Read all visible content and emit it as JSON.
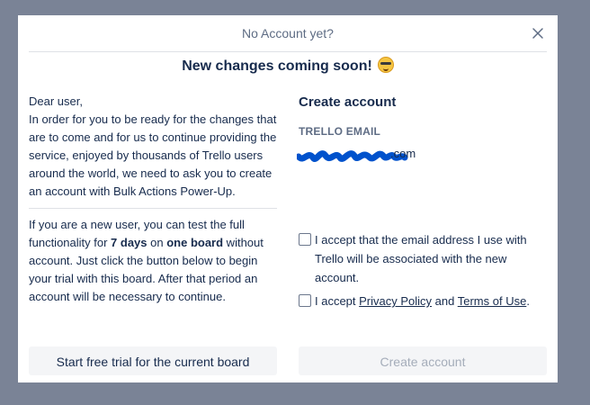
{
  "modal": {
    "title": "No Account yet?",
    "subtitle": "New changes coming soon!"
  },
  "left": {
    "para1": "Dear user,\nIn order for you to be ready for the changes that are to come and for us to continue providing the service, enjoyed by thousands of Trello users around the world, we need to ask you to create an account with Bulk Actions Power-Up.",
    "para2": {
      "part1": "If you are a new user, you can test the full functionality for ",
      "bold1": "7 days",
      "part2": " on ",
      "bold2": "one board",
      "part3": " without account. Just click the button below to begin your trial with this board. After that period an account will be necessary to continue."
    },
    "trial_button": "Start free trial for the current board"
  },
  "right": {
    "title": "Create account",
    "email_label": "TRELLO EMAIL",
    "email_value": ".com",
    "checkbox1": "I accept that the email address I use with Trello will be associated with the new account.",
    "checkbox2_prefix": "I accept ",
    "privacy_link": "Privacy Policy",
    "checkbox2_and": " and ",
    "terms_link": "Terms of Use",
    "checkbox2_suffix": ".",
    "create_button": "Create account"
  },
  "icons": {
    "close": "close-icon",
    "emoji": "emoji-icon"
  },
  "colors": {
    "backdrop": "#7a8396",
    "redaction": "#0052cc",
    "disabled_text": "#a5adba"
  }
}
